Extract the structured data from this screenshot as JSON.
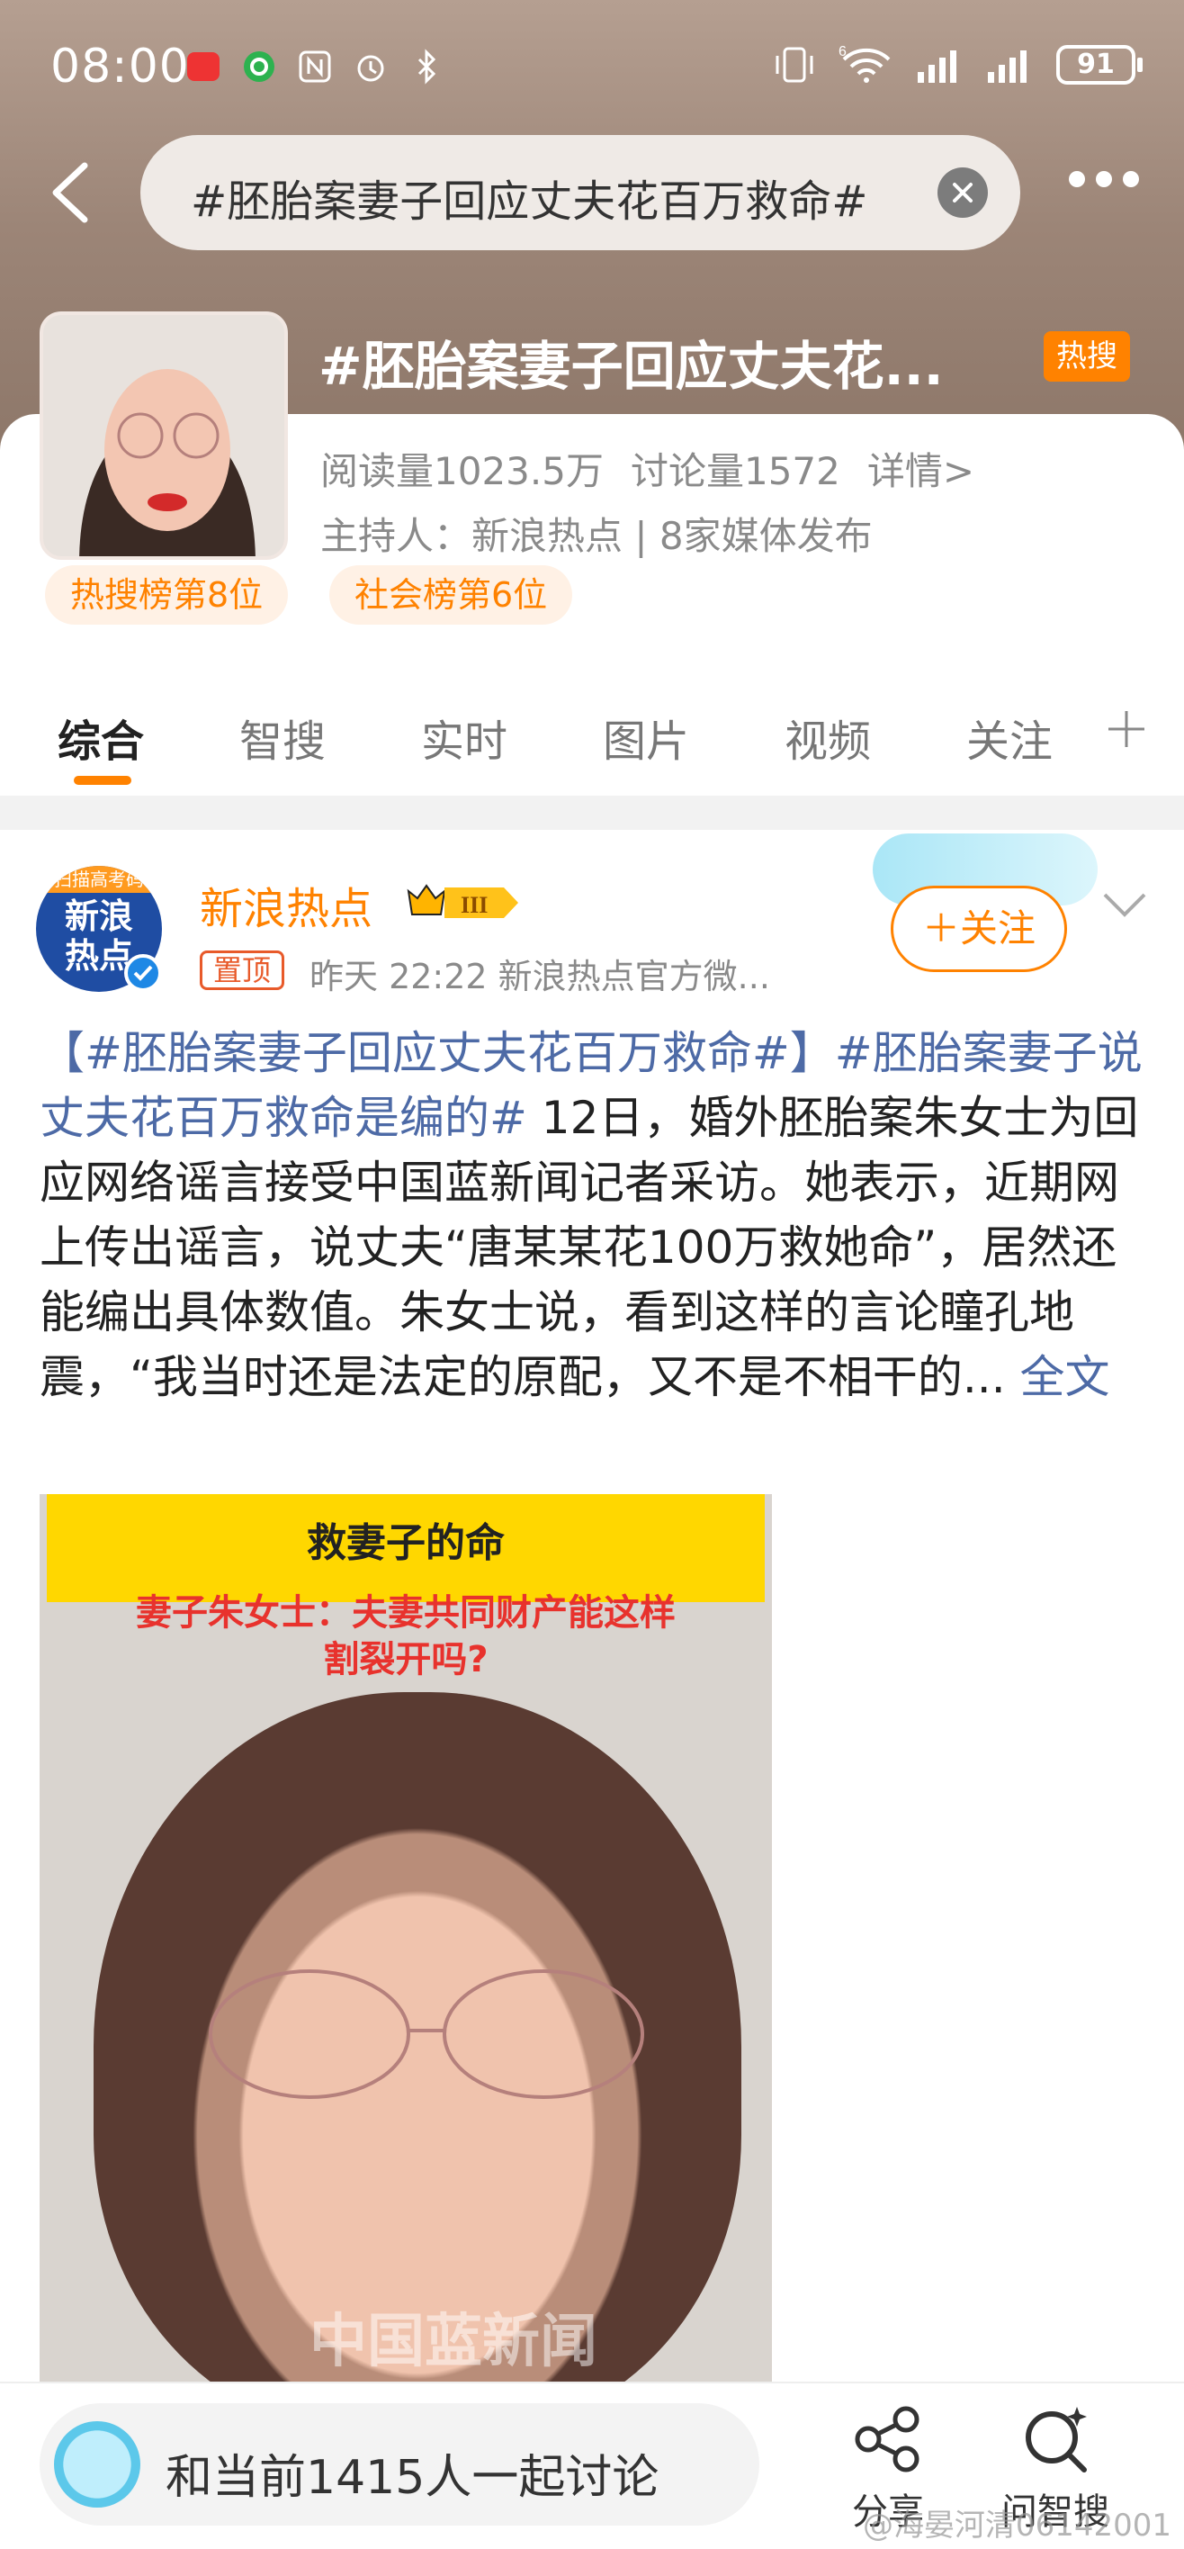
{
  "status_bar": {
    "time": "08:00",
    "battery": "91",
    "network_label": "6"
  },
  "search": {
    "query": "#胚胎案妻子回应丈夫花百万救命#"
  },
  "topic": {
    "title": "#胚胎案妻子回应丈夫花...",
    "hot_badge": "热搜",
    "reads": "阅读量1023.5万",
    "discussions": "讨论量1572",
    "details": "详情>",
    "host": "主持人：新浪热点 | 8家媒体发布",
    "rank_hot": "热搜榜第8位",
    "rank_social": "社会榜第6位"
  },
  "tabs": [
    "综合",
    "智搜",
    "实时",
    "图片",
    "视频",
    "关注"
  ],
  "post": {
    "avatar_ribbon": "扫描高考码",
    "avatar_text_1": "新浪",
    "avatar_text_2": "热点",
    "username": "新浪热点",
    "vip_level": "III",
    "pin_tag": "置顶",
    "meta": "昨天 22:22   新浪热点官方微...",
    "follow_label": "＋关注",
    "body": {
      "topic1": "【#胚胎案妻子回应丈夫花百万救命#】",
      "topic2": "#胚胎案妻子说丈夫花百万救命是编的#",
      "text": " 12日，婚外胚胎案朱女士为回应网络谣言接受中国蓝新闻记者采访。她表示，近期网上传出谣言，说丈夫“唐某某花100万救她命”，居然还能编出具体数值。朱女士说，看到这样的言论瞳孔地震，“我当时还是法定的原配，又不是不相干的...",
      "more": " 全文"
    },
    "image": {
      "caption_yellow": "救妻子的命",
      "caption_red_1": "妻子朱女士：夫妻共同财产能这样",
      "caption_red_2": "割裂开吗?",
      "watermark": "中国蓝新闻"
    }
  },
  "bottom": {
    "discuss": "和当前1415人一起讨论",
    "share": "分享",
    "ask": "问智搜",
    "watermark": "@海晏河清06142001"
  },
  "colors": {
    "accent": "#ff8200",
    "link": "#4d6aa6",
    "header": "#9c8577"
  }
}
